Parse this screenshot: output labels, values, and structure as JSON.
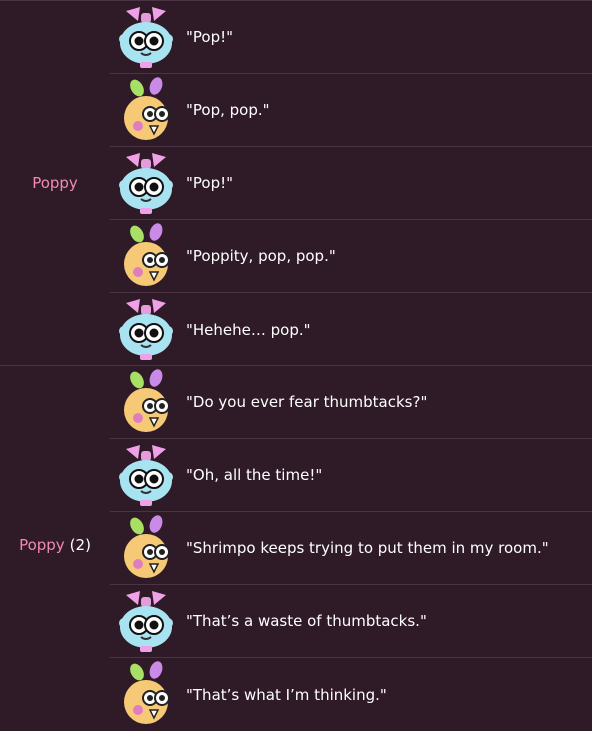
{
  "groups": [
    {
      "name": "Poppy",
      "suffix": "",
      "lines": [
        {
          "speaker": "blue",
          "text": "\"Pop!\""
        },
        {
          "speaker": "yellow",
          "text": "\"Pop, pop.\""
        },
        {
          "speaker": "blue",
          "text": "\"Pop!\""
        },
        {
          "speaker": "yellow",
          "text": "\"Poppity, pop, pop.\""
        },
        {
          "speaker": "blue",
          "text": "\"Hehehe… pop.\""
        }
      ]
    },
    {
      "name": "Poppy",
      "suffix": "(2)",
      "lines": [
        {
          "speaker": "yellow",
          "text": "\"Do you ever fear thumbtacks?\""
        },
        {
          "speaker": "blue",
          "text": "\"Oh, all the time!\""
        },
        {
          "speaker": "yellow",
          "text": "\"Shrimpo keeps trying to put them in my room.\""
        },
        {
          "speaker": "blue",
          "text": "\"That’s a waste of thumbtacks.\""
        },
        {
          "speaker": "yellow",
          "text": "\"That’s what I’m thinking.\""
        }
      ]
    }
  ]
}
